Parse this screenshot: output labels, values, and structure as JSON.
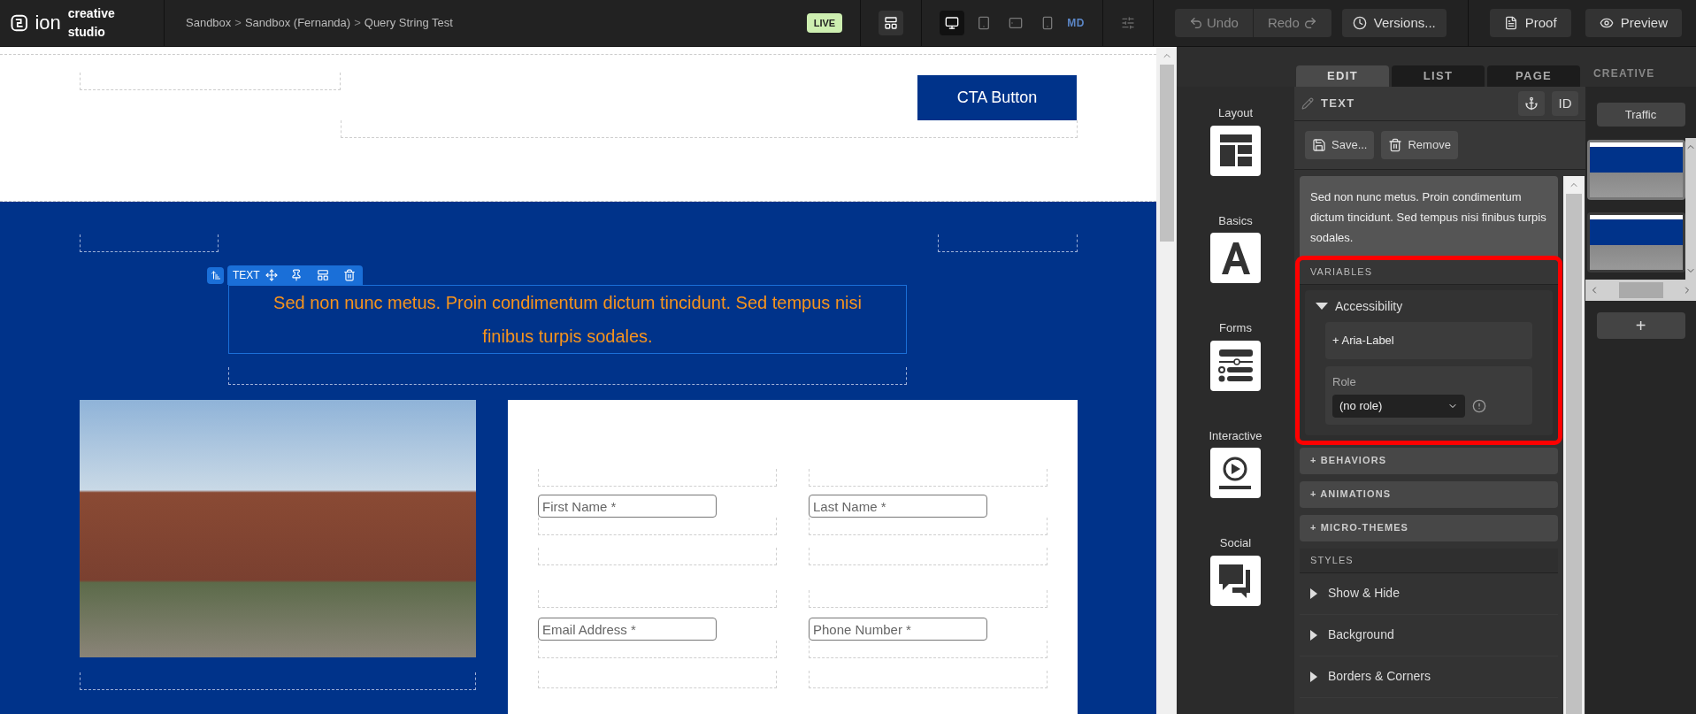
{
  "app": {
    "logo": "ion",
    "product": "creative studio"
  },
  "breadcrumbs": [
    {
      "kind": "crumb",
      "label": "Sandbox"
    },
    {
      "kind": "separator",
      "label": ">"
    },
    {
      "kind": "crumb",
      "label": "Sandbox (Fernanda)"
    },
    {
      "kind": "separator",
      "label": ">"
    },
    {
      "kind": "crumb",
      "label": "Query String Test"
    }
  ],
  "status_badge": "LIVE",
  "devices": [
    {
      "kind": "desktop",
      "selected": true
    },
    {
      "kind": "tablet",
      "selected": false
    },
    {
      "kind": "tablet-landscape",
      "selected": false
    },
    {
      "kind": "phone",
      "selected": false
    }
  ],
  "breakpoint": "MD",
  "undo": {
    "label": "Undo",
    "disabled": true
  },
  "redo": {
    "label": "Redo",
    "disabled": true
  },
  "versions": "Versions...",
  "proof": "Proof",
  "preview": "Preview",
  "canvas": {
    "cta": "CTA Button",
    "element_toolbar": "TEXT",
    "headline": "Sed non nunc metus. Proin condimentum dictum tincidunt. Sed tempus nisi finibus turpis sodales.",
    "fields": [
      {
        "placeholder": "First Name *"
      },
      {
        "placeholder": "Last Name *"
      },
      {
        "placeholder": "Email Address *"
      },
      {
        "placeholder": "Phone Number *"
      }
    ]
  },
  "components": [
    {
      "kind": "layout",
      "label": "Layout"
    },
    {
      "kind": "basics",
      "label": "Basics"
    },
    {
      "kind": "forms",
      "label": "Forms"
    },
    {
      "kind": "interactive",
      "label": "Interactive"
    },
    {
      "kind": "social",
      "label": "Social"
    }
  ],
  "tabs": [
    {
      "label": "EDIT",
      "selected": true
    },
    {
      "label": "LIST",
      "selected": false
    },
    {
      "label": "PAGE",
      "selected": false
    }
  ],
  "creative_header": "CREATIVE",
  "editor": {
    "element_type": "TEXT",
    "id_button": "ID",
    "save": "Save...",
    "remove": "Remove",
    "text_preview": "Sed non nunc metus. Proin condimentum dictum tincidunt. Sed tempus nisi finibus turpis sodales.",
    "variables": {
      "title": "VARIABLES",
      "highlighted": true,
      "group": {
        "title": "Accessibility",
        "expanded": true,
        "add_label": "+ Aria-Label",
        "role_label": "Role",
        "role_value": "(no role)"
      }
    },
    "sections": [
      "+ BEHAVIORS",
      "+ ANIMATIONS",
      "+ MICRO-THEMES"
    ],
    "styles": {
      "title": "STYLES",
      "items": [
        {
          "label": "Show & Hide",
          "expanded": false
        },
        {
          "label": "Background",
          "expanded": false
        },
        {
          "label": "Borders & Corners",
          "expanded": false
        }
      ]
    }
  },
  "traffic": "Traffic",
  "thumbnails": [
    {
      "selected": true
    },
    {
      "selected": false
    }
  ],
  "add_button": "+"
}
